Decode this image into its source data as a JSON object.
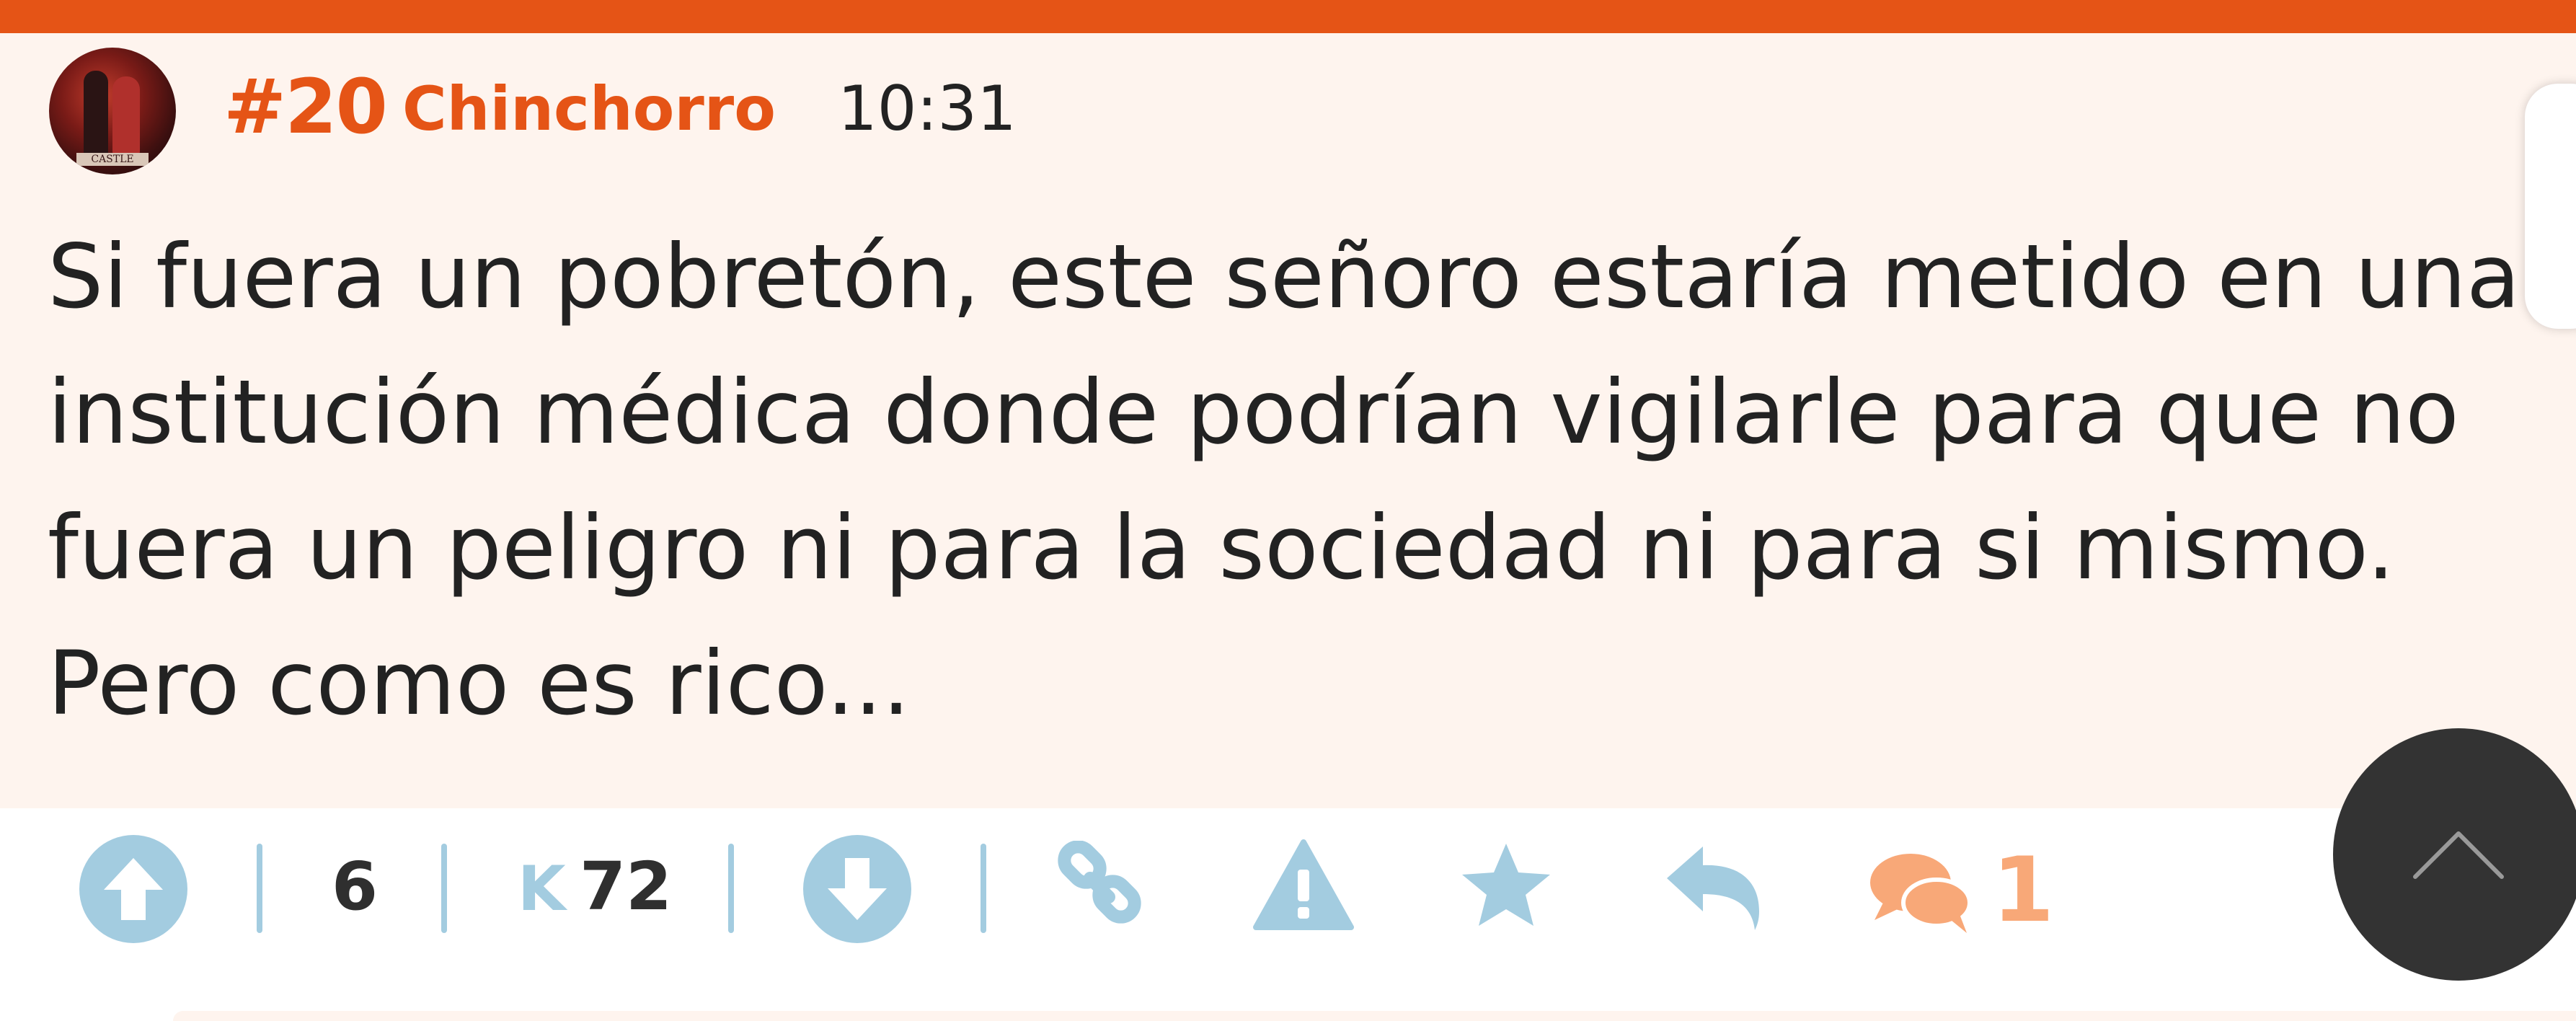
{
  "comment": {
    "number": "#20",
    "username": "Chinchorro",
    "time": "10:31",
    "avatar_text": "CASTLE",
    "text": "Si fuera un pobretón, este señoro estaría metido en una institución médica donde podrían vigilarle para que no fuera un peligro ni para la sociedad ni para si mismo. Pero como es rico..."
  },
  "actions": {
    "votes": "6",
    "karma_label": "K",
    "karma": "72",
    "replies_count": "1"
  },
  "icons": {
    "upvote": "arrow-up-circle-icon",
    "downvote": "arrow-down-circle-icon",
    "link": "link-icon",
    "report": "warning-triangle-icon",
    "favorite": "star-icon",
    "reply": "reply-arrow-icon",
    "comments": "speech-bubbles-icon",
    "scroll_top": "chevron-up-icon"
  },
  "colors": {
    "brand": "#e55416",
    "comment_bg": "#fef4ee",
    "action_blue": "#a3cce0",
    "comments_orange": "#f8a878",
    "text": "#222222"
  }
}
